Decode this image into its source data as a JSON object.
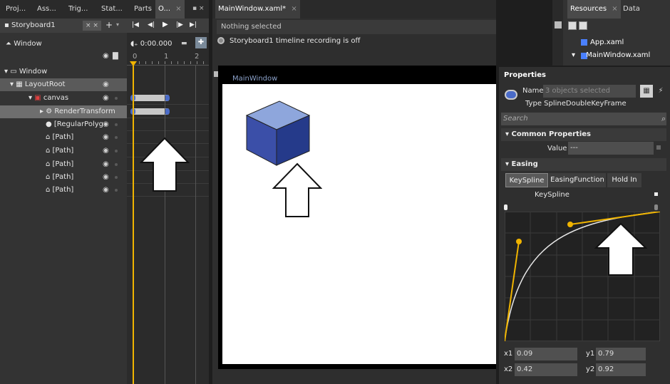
{
  "left_tabs": [
    "Proj...",
    "Ass...",
    "Trig...",
    "Stat...",
    "Parts",
    "O..."
  ],
  "storyboard": {
    "name": "Storyboard1",
    "time": "0:00.000",
    "ruler": [
      "0",
      "1",
      "2"
    ]
  },
  "tree": {
    "scope": "Window",
    "items": [
      {
        "label": "Window",
        "level": 0
      },
      {
        "label": "LayoutRoot",
        "level": 1
      },
      {
        "label": "canvas",
        "level": 2
      },
      {
        "label": "RenderTransform",
        "level": 3
      },
      {
        "label": "[RegularPolyg",
        "level": 3
      },
      {
        "label": "[Path]",
        "level": 3
      },
      {
        "label": "[Path]",
        "level": 3
      },
      {
        "label": "[Path]",
        "level": 3
      },
      {
        "label": "[Path]",
        "level": 3
      },
      {
        "label": "[Path]",
        "level": 3
      }
    ]
  },
  "document": {
    "tab": "MainWindow.xaml*",
    "selection": "Nothing selected",
    "recording": "Storyboard1 timeline recording is off",
    "window_title": "MainWindow"
  },
  "resources": {
    "tabs": [
      "Resources",
      "Data"
    ],
    "items": [
      "App.xaml",
      "MainWindow.xaml"
    ]
  },
  "properties": {
    "title": "Properties",
    "name_label": "Name",
    "name_placeholder": "3 objects selected",
    "type_label": "Type",
    "type_value": "SplineDoubleKeyFrame",
    "search_placeholder": "Search",
    "common_section": "Common Properties",
    "value_label": "Value",
    "value_value": "---",
    "easing_section": "Easing",
    "easing_tabs": [
      "KeySpline",
      "EasingFunction",
      "Hold In"
    ],
    "keyspline_label": "KeySpline",
    "x1": "0.09",
    "y1": "0.79",
    "x2": "0.42",
    "y2": "0.92",
    "x1_label": "x1",
    "y1_label": "y1",
    "x2_label": "x2",
    "y2_label": "y2"
  },
  "colors": {
    "accent": "#f0b400",
    "canvas": "#ffffff",
    "cube_top": "#8ea6dc",
    "cube_left": "#3b4fa8",
    "cube_right": "#253a8a"
  }
}
